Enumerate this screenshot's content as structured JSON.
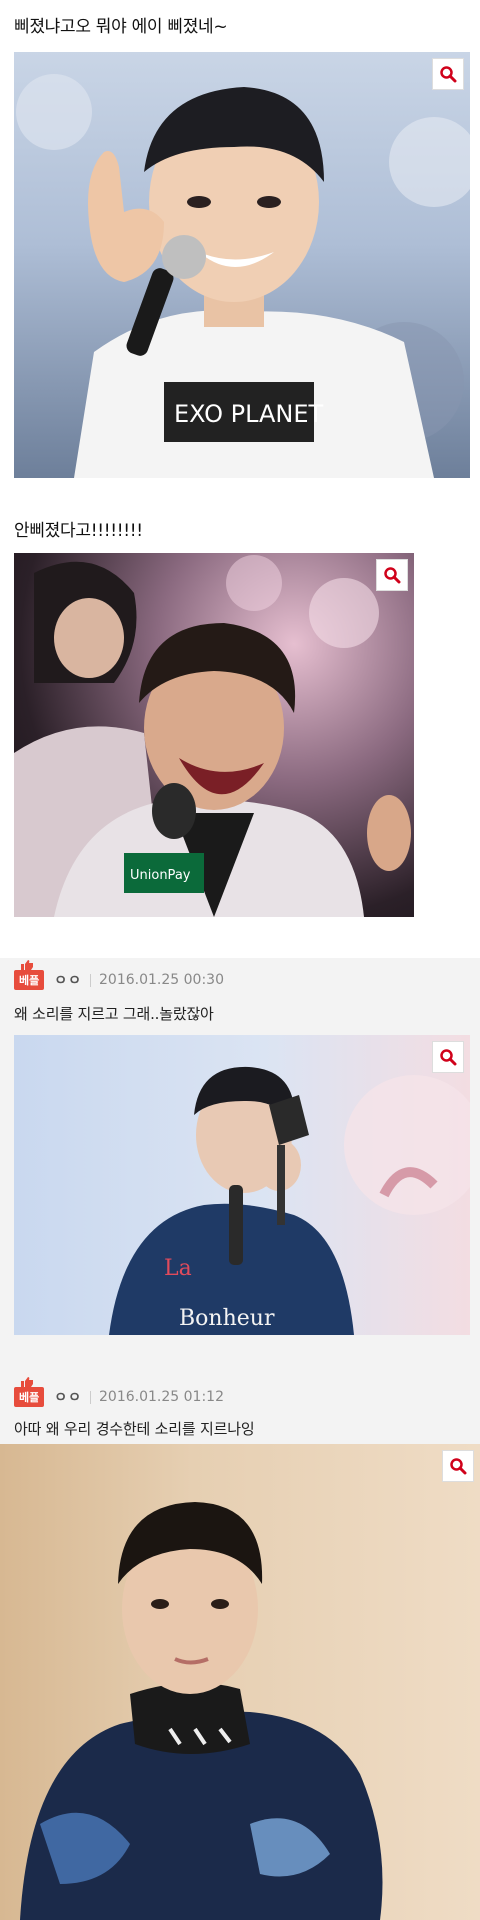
{
  "posts": [
    {
      "caption": "삐졌냐고오 뭐야 에이 삐졌네~"
    },
    {
      "caption": "안삐졌다고!!!!!!!!"
    }
  ],
  "comments": [
    {
      "badge": "베플",
      "user": "ㅇㅇ",
      "timestamp": "2016.01.25 00:30",
      "text": "왜 소리를 지르고 그래..놀랐잖아"
    },
    {
      "badge": "베플",
      "user": "ㅇㅇ",
      "timestamp": "2016.01.25 01:12",
      "text": "아따 왜 우리 경수한테 소리를 지르나잉"
    }
  ],
  "images": [
    {
      "logo_text": "EXO PLANET"
    },
    {
      "logo_text": "UnionPay"
    },
    {
      "logo_text": "Bonheur"
    }
  ],
  "colors": {
    "badge": "#e74c3c",
    "comment_bg": "#f3f3f3",
    "zoom_icon": "#d0021b"
  },
  "icons": {
    "zoom": "magnifier-icon",
    "badge_crown": "thumbs-up-icon"
  }
}
